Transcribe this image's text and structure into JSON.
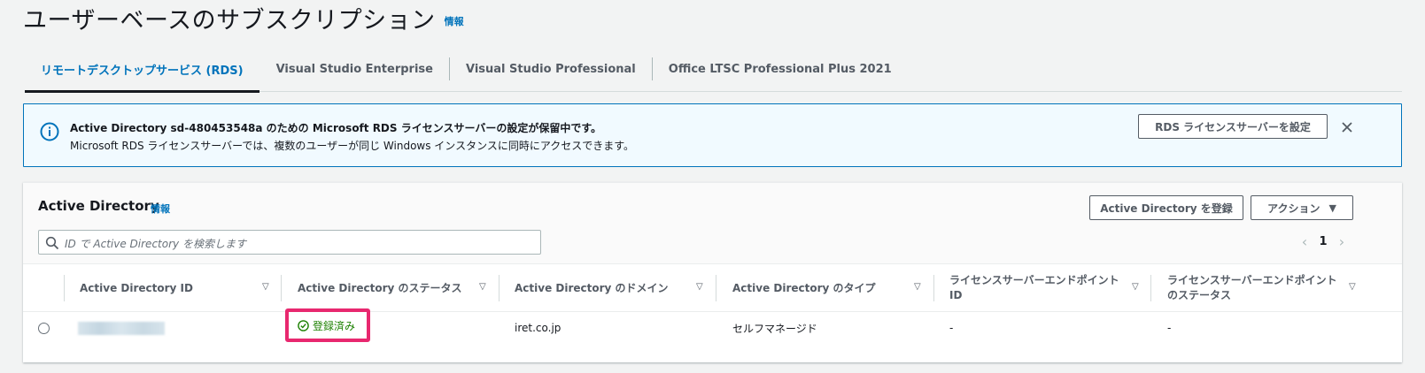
{
  "header": {
    "title": "ユーザーベースのサブスクリプション",
    "info": "情報"
  },
  "tabs": [
    {
      "label": "リモートデスクトップサービス (RDS)",
      "active": true
    },
    {
      "label": "Visual Studio Enterprise",
      "active": false
    },
    {
      "label": "Visual Studio Professional",
      "active": false
    },
    {
      "label": "Office LTSC Professional Plus 2021",
      "active": false
    }
  ],
  "flash": {
    "title": "Active Directory sd-480453548a のための Microsoft RDS ライセンスサーバーの設定が保留中です。",
    "body": "Microsoft RDS ライセンスサーバーでは、複数のユーザーが同じ Windows インスタンスに同時にアクセスできます。",
    "button": "RDS ライセンスサーバーを設定",
    "icon": "info-circle-icon",
    "accent": "#0073bb"
  },
  "panel": {
    "title": "Active Directory",
    "info": "情報",
    "register_button": "Active Directory を登録",
    "actions_button": "アクション",
    "search_placeholder": "ID で Active Directory を検索します",
    "page": "1"
  },
  "table": {
    "columns": [
      "Active Directory ID",
      "Active Directory のステータス",
      "Active Directory のドメイン",
      "Active Directory のタイプ",
      "ライセンスサーバーエンドポイント ID",
      "ライセンスサーバーエンドポイントのステータス"
    ],
    "rows": [
      {
        "id": "",
        "status": "登録済み",
        "domain": "iret.co.jp",
        "type": "セルフマネージド",
        "endpoint_id": "-",
        "endpoint_status": "-"
      }
    ]
  },
  "colors": {
    "link": "#0073bb",
    "success": "#1d8102",
    "highlight": "#e8286f"
  }
}
